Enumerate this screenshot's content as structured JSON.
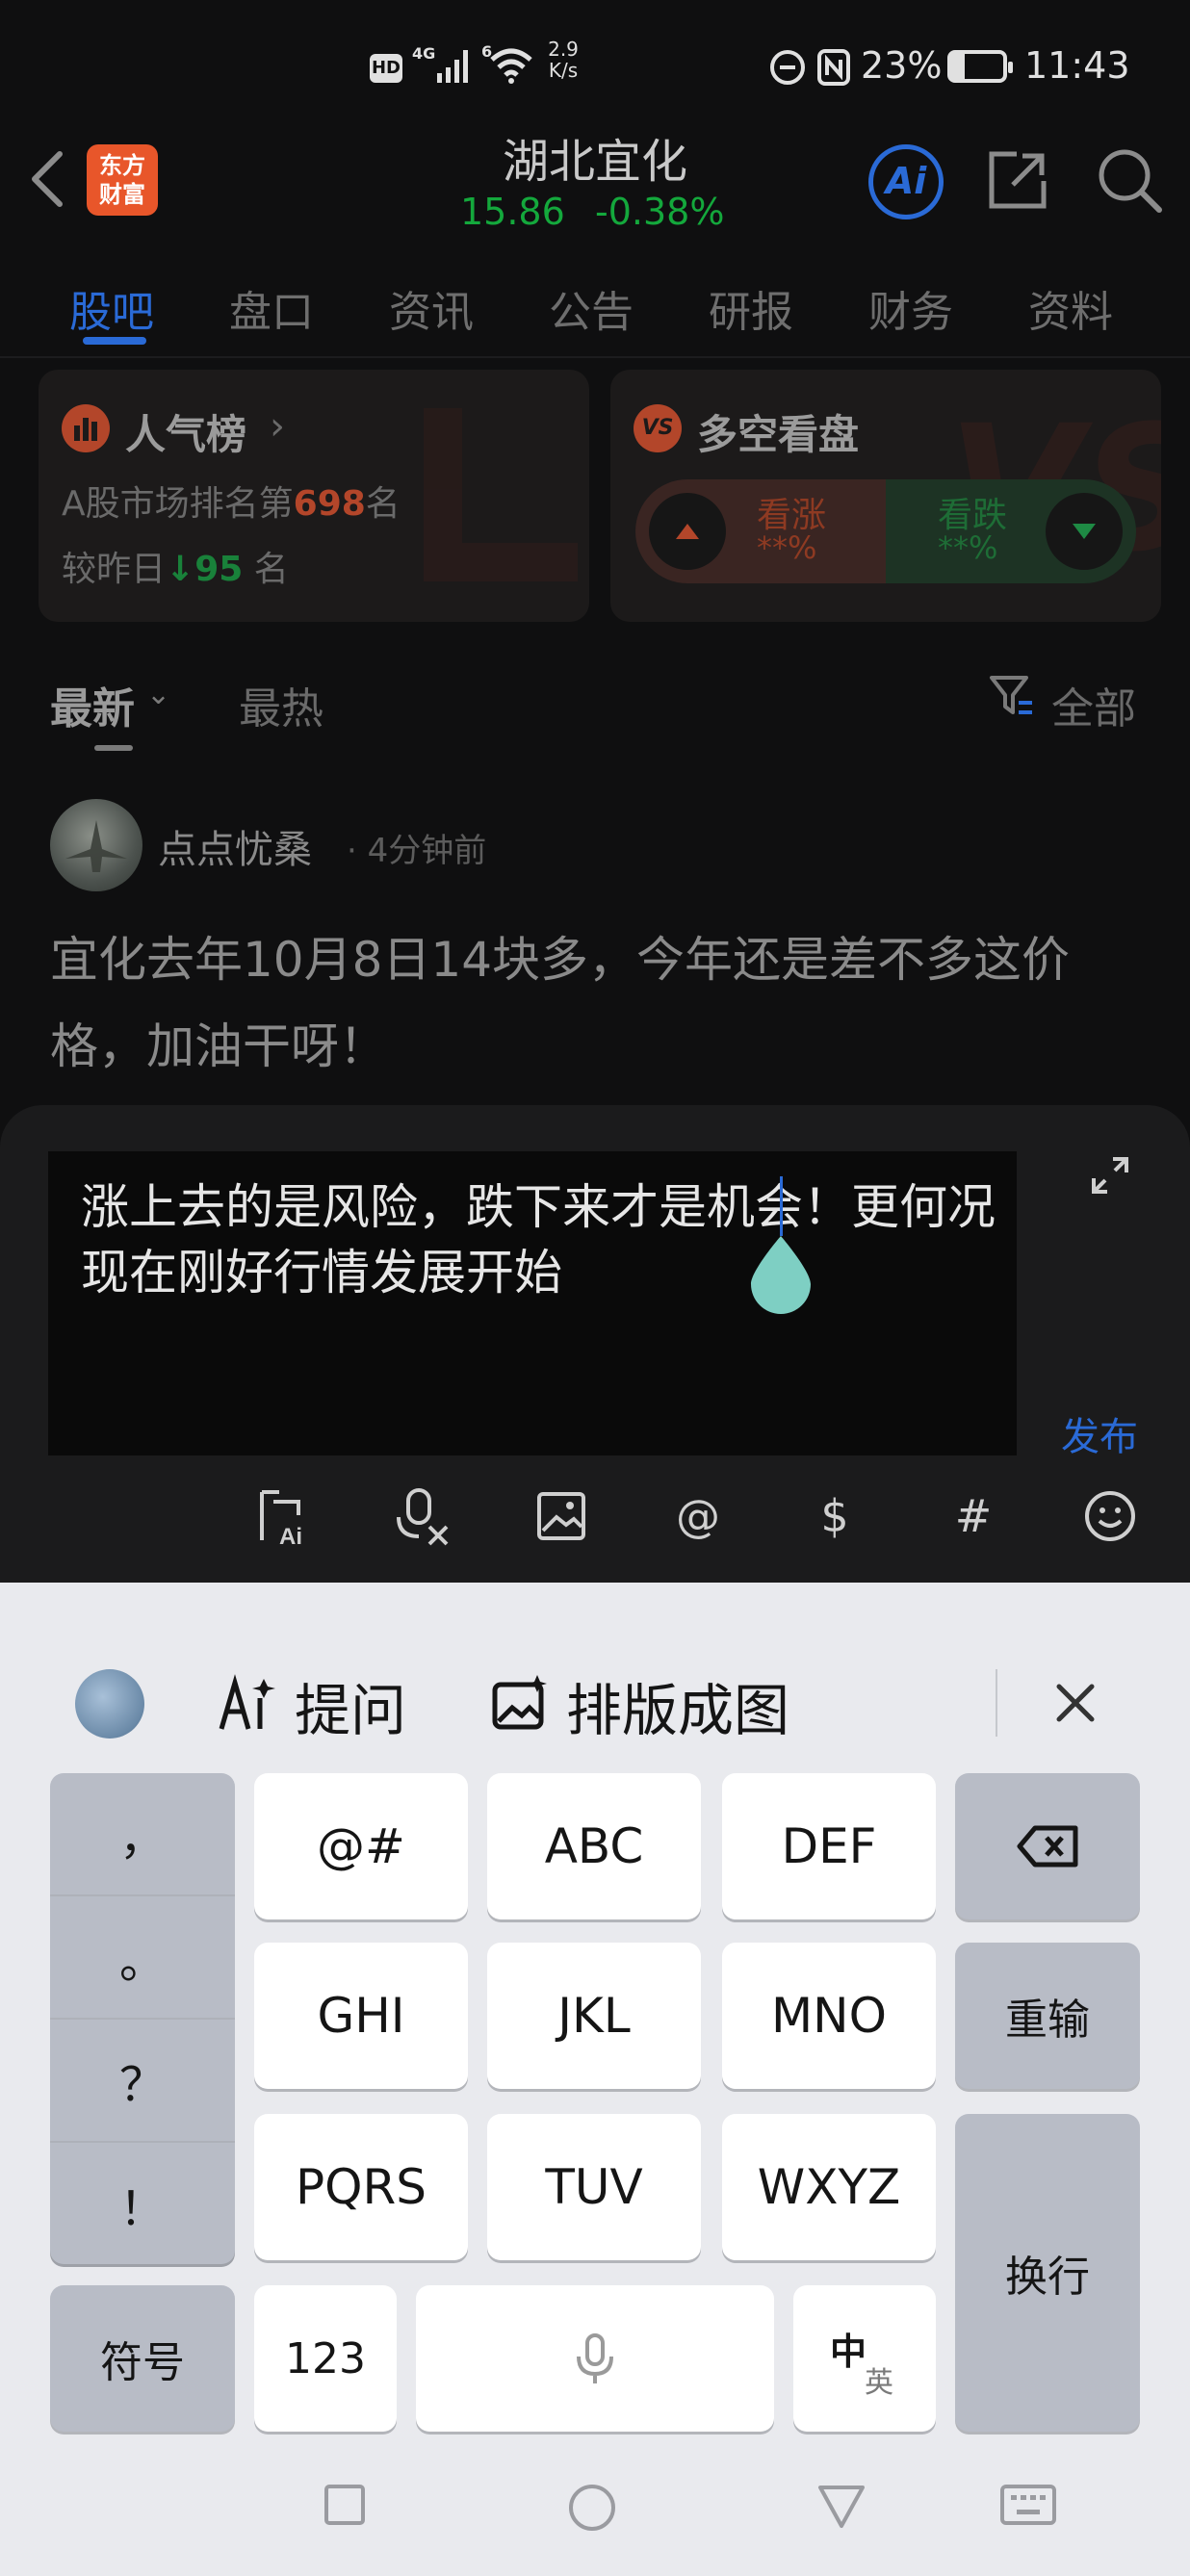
{
  "status_bar": {
    "hd": "HD",
    "network": "4G",
    "speed_value": "2.9",
    "speed_unit": "K/s",
    "battery": "23%",
    "time": "11:43",
    "signal_6": "6"
  },
  "header": {
    "logo_line1": "东方",
    "logo_line2": "财富",
    "title": "湖北宜化",
    "price": "15.86",
    "change_pct": "-0.38%",
    "ai_label": "Ai"
  },
  "tabs": [
    {
      "label": "股吧",
      "active": true
    },
    {
      "label": "盘口",
      "active": false
    },
    {
      "label": "资讯",
      "active": false
    },
    {
      "label": "公告",
      "active": false
    },
    {
      "label": "研报",
      "active": false
    },
    {
      "label": "财务",
      "active": false
    },
    {
      "label": "资料",
      "active": false
    }
  ],
  "popularity_card": {
    "title": "人气榜",
    "line1_prefix": "A股市场排名第",
    "rank": "698",
    "line1_suffix": "名",
    "line2_prefix": "较昨日",
    "change": "95",
    "line2_suffix": "名"
  },
  "vs_card": {
    "badge": "VS",
    "title": "多空看盘",
    "up_label": "看涨",
    "up_value": "**%",
    "down_label": "看跌",
    "down_value": "**%"
  },
  "filters": {
    "latest": "最新",
    "hottest": "最热",
    "all": "全部"
  },
  "post": {
    "username": "点点忧桑",
    "time": "· 4分钟前",
    "text": "宜化去年10月8日14块多，今年还是差不多这价格，加油干呀！"
  },
  "reply": {
    "text": "涨上去的是风险，跌下来才是机会！更何况现在刚好行情发展开始",
    "publish_label": "发布"
  },
  "keyboard": {
    "ask_label": "提问",
    "layout_label": "排版成图",
    "punct": [
      "，",
      "。",
      "？",
      "！"
    ],
    "row1": [
      "@#",
      "ABC",
      "DEF"
    ],
    "row2": [
      "GHI",
      "JKL",
      "MNO"
    ],
    "row3": [
      "PQRS",
      "TUV",
      "WXYZ"
    ],
    "reenter": "重输",
    "newline": "换行",
    "symbols": "符号",
    "num": "123",
    "lang_main": "中",
    "lang_alt": "英"
  },
  "colors": {
    "accent_blue": "#2a6ad6",
    "price_green": "#14a83c",
    "rank_orange": "#b3462a"
  }
}
